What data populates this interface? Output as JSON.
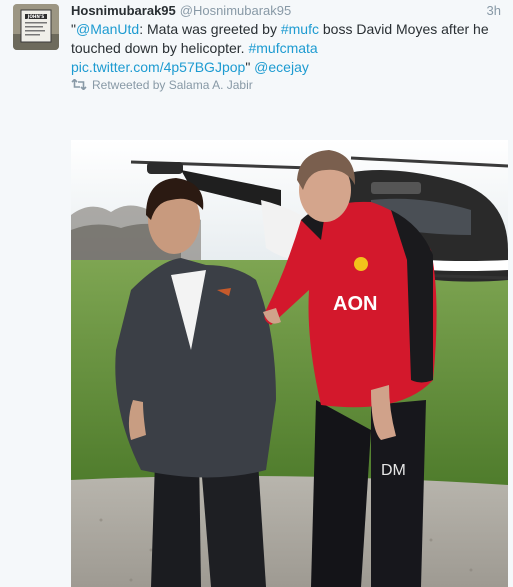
{
  "tweet": {
    "display_name": "Hosnimubarak95",
    "handle": "@Hosnimubarak95",
    "time": "3h",
    "text": {
      "open_quote": "\"",
      "mention_manutd": "@ManUtd",
      "part1": ": Mata was greeted by ",
      "hashtag_mufc": "#mufc",
      "part2": " boss David Moyes after he touched down by helicopter. ",
      "hashtag_mufcmata": "#mufcmata",
      "pic_link": "pic.twitter.com/4p57BGJpop",
      "close_quote": "\" ",
      "mention_ecejay": "@ecejay"
    },
    "retweeted_by": "Retweeted by Salama A. Jabir"
  },
  "avatar": {
    "sign_title": "JOHN'S"
  },
  "photo": {
    "shirt_sponsor": "AON",
    "shirt_initials": "DM",
    "shirt_badge_letter": "DM"
  },
  "colors": {
    "link": "#1d9bd1",
    "muted": "#8899a6",
    "background": "#f5f8fa",
    "text": "#292f33",
    "jacket_red": "#d3182c"
  },
  "icons": {
    "retweet": "retweet-icon"
  }
}
